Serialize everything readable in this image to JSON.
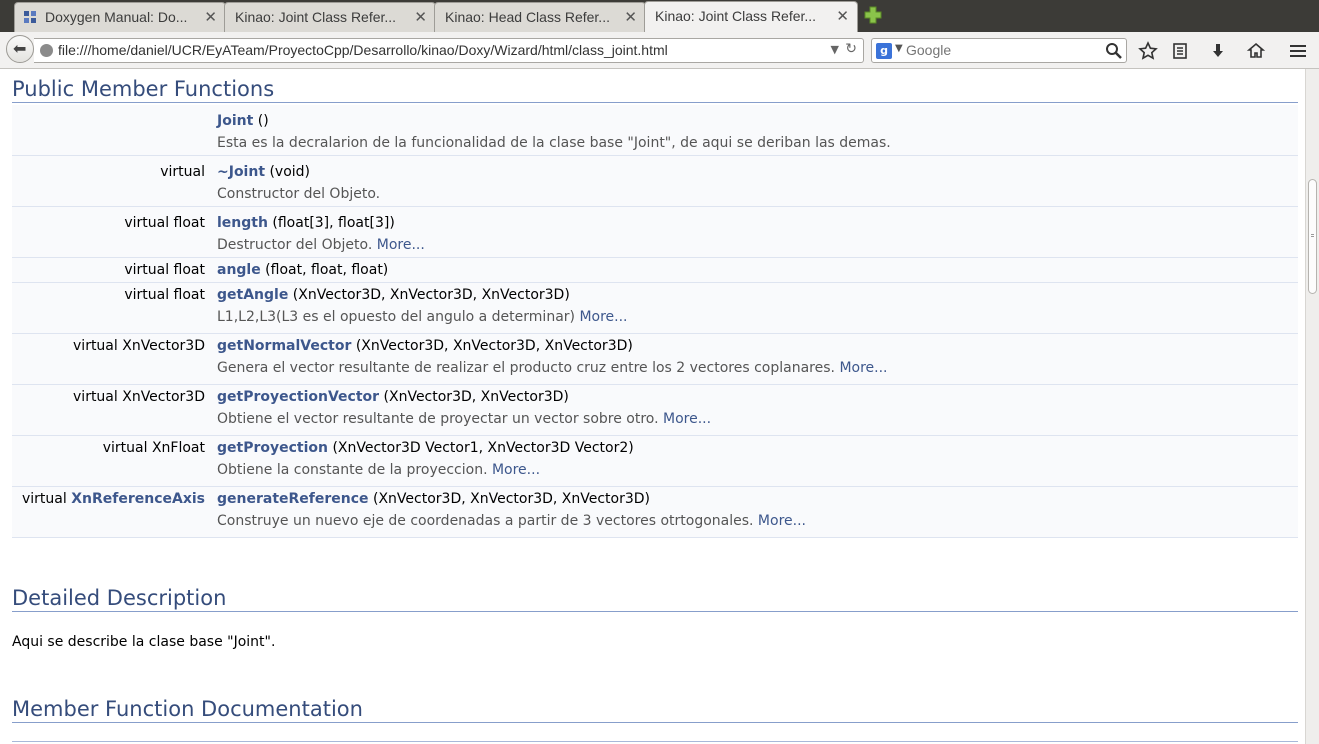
{
  "tabs": [
    {
      "title": "Doxygen Manual: Do...",
      "active": false
    },
    {
      "title": "Kinao: Joint Class Refer...",
      "active": false
    },
    {
      "title": "Kinao: Head Class Refer...",
      "active": false
    },
    {
      "title": "Kinao: Joint Class Refer...",
      "active": true
    }
  ],
  "address": {
    "url": "file:///home/daniel/UCR/EyATeam/ProyectoCpp/Desarrollo/kinao/Doxy/Wizard/html/class_joint.html"
  },
  "search": {
    "placeholder": "Google"
  },
  "sections": {
    "public": "Public Member Functions",
    "detailed": "Detailed Description",
    "memberdoc": "Member Function Documentation"
  },
  "members": [
    {
      "ret": "",
      "ret_link": "",
      "name": "Joint",
      "args": " ()",
      "desc": "Esta es la decralarion de la funcionalidad de la clase base \"Joint\", de aqui se deriban las demas.",
      "more": ""
    },
    {
      "ret": "virtual",
      "ret_link": "",
      "name": "~Joint",
      "args": " (void)",
      "desc": "Constructor del Objeto.",
      "more": ""
    },
    {
      "ret": "virtual float",
      "ret_link": "",
      "name": "length",
      "args": " (float[3], float[3])",
      "desc": "Destructor del Objeto. ",
      "more": "More..."
    },
    {
      "ret": "virtual float",
      "ret_link": "",
      "name": "angle",
      "args": " (float, float, float)",
      "desc": "",
      "more": ""
    },
    {
      "ret": "virtual float",
      "ret_link": "",
      "name": "getAngle",
      "args": " (XnVector3D, XnVector3D, XnVector3D)",
      "desc": "L1,L2,L3(L3 es el opuesto del angulo a determinar) ",
      "more": "More..."
    },
    {
      "ret": "virtual XnVector3D",
      "ret_link": "",
      "name": "getNormalVector",
      "args": " (XnVector3D, XnVector3D, XnVector3D)",
      "desc": "Genera el vector resultante de realizar el producto cruz entre los 2 vectores coplanares. ",
      "more": "More..."
    },
    {
      "ret": "virtual XnVector3D",
      "ret_link": "",
      "name": "getProyectionVector",
      "args": " (XnVector3D, XnVector3D)",
      "desc": "Obtiene el vector resultante de proyectar un vector sobre otro. ",
      "more": "More..."
    },
    {
      "ret": "virtual XnFloat",
      "ret_link": "",
      "name": "getProyection",
      "args": " (XnVector3D Vector1, XnVector3D Vector2)",
      "desc": "Obtiene la constante de la proyeccion. ",
      "more": "More..."
    },
    {
      "ret": "virtual ",
      "ret_link": "XnReferenceAxis",
      "name": "generateReference",
      "args": " (XnVector3D, XnVector3D, XnVector3D)",
      "desc": "Construye un nuevo eje de coordenadas a partir de 3 vectores otrtogonales. ",
      "more": "More..."
    }
  ],
  "detail": {
    "text": "Aqui se describe la clase base \"Joint\"."
  },
  "colors": {
    "heading": "#354c7b",
    "link": "#3d578c",
    "rule": "#879ecb",
    "row_bg": "#f9fafc"
  }
}
